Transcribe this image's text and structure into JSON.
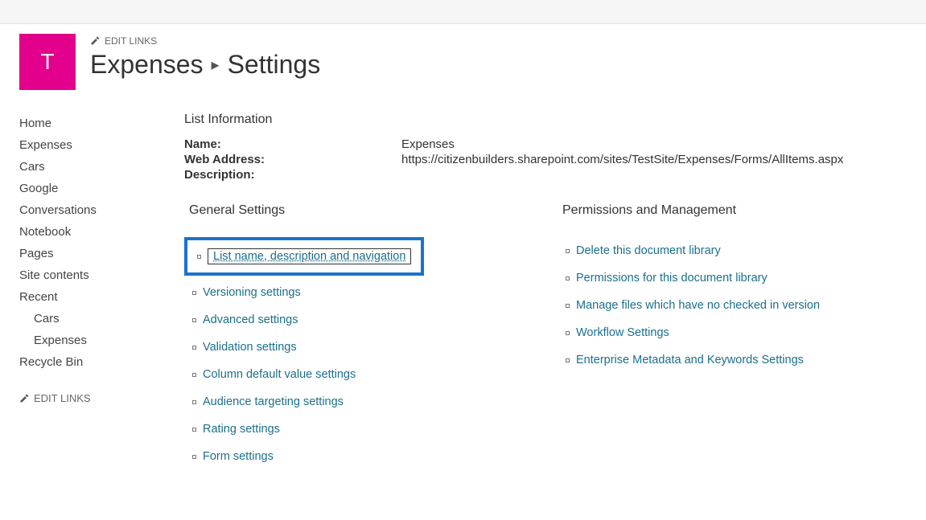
{
  "site_tile_letter": "T",
  "edit_links_label": "EDIT LINKS",
  "breadcrumb": {
    "site": "Expenses",
    "page": "Settings"
  },
  "sidebar": {
    "items": [
      {
        "label": "Home"
      },
      {
        "label": "Expenses"
      },
      {
        "label": "Cars"
      },
      {
        "label": "Google"
      },
      {
        "label": "Conversations"
      },
      {
        "label": "Notebook"
      },
      {
        "label": "Pages"
      },
      {
        "label": "Site contents"
      },
      {
        "label": "Recent"
      },
      {
        "label": "Cars",
        "sub": true
      },
      {
        "label": "Expenses",
        "sub": true
      },
      {
        "label": "Recycle Bin"
      }
    ],
    "edit_links_label": "EDIT LINKS"
  },
  "list_info": {
    "heading": "List Information",
    "rows": {
      "name_label": "Name:",
      "name_value": "Expenses",
      "web_label": "Web Address:",
      "web_value": "https://citizenbuilders.sharepoint.com/sites/TestSite/Expenses/Forms/AllItems.aspx",
      "desc_label": "Description:",
      "desc_value": ""
    }
  },
  "general": {
    "title": "General Settings",
    "items": [
      "List name, description and navigation",
      "Versioning settings",
      "Advanced settings",
      "Validation settings",
      "Column default value settings",
      "Audience targeting settings",
      "Rating settings",
      "Form settings"
    ]
  },
  "permissions": {
    "title": "Permissions and Management",
    "items": [
      "Delete this document library",
      "Permissions for this document library",
      "Manage files which have no checked in version",
      "Workflow Settings",
      "Enterprise Metadata and Keywords Settings"
    ]
  }
}
